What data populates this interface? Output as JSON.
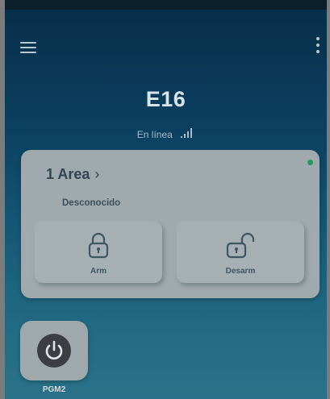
{
  "header": {
    "menu_icon": "hamburger-menu-icon",
    "more_icon": "vertical-dots-icon"
  },
  "device": {
    "name": "E16",
    "status": "En línea",
    "signal_icon": "signal-bars-icon"
  },
  "area": {
    "title": "1 Area",
    "chevron": "›",
    "state": "Desconocido",
    "online_indicator_color": "#1e9a5a",
    "actions": [
      {
        "label": "Arm",
        "icon": "lock-closed-icon"
      },
      {
        "label": "Desarm",
        "icon": "lock-open-icon"
      }
    ]
  },
  "pgm": {
    "label": "PGM2",
    "icon": "power-icon"
  },
  "colors": {
    "background_top": "#082f49",
    "background_bottom": "#2b7289",
    "card": "#9fa9ae",
    "card_text": "#2f4552"
  }
}
